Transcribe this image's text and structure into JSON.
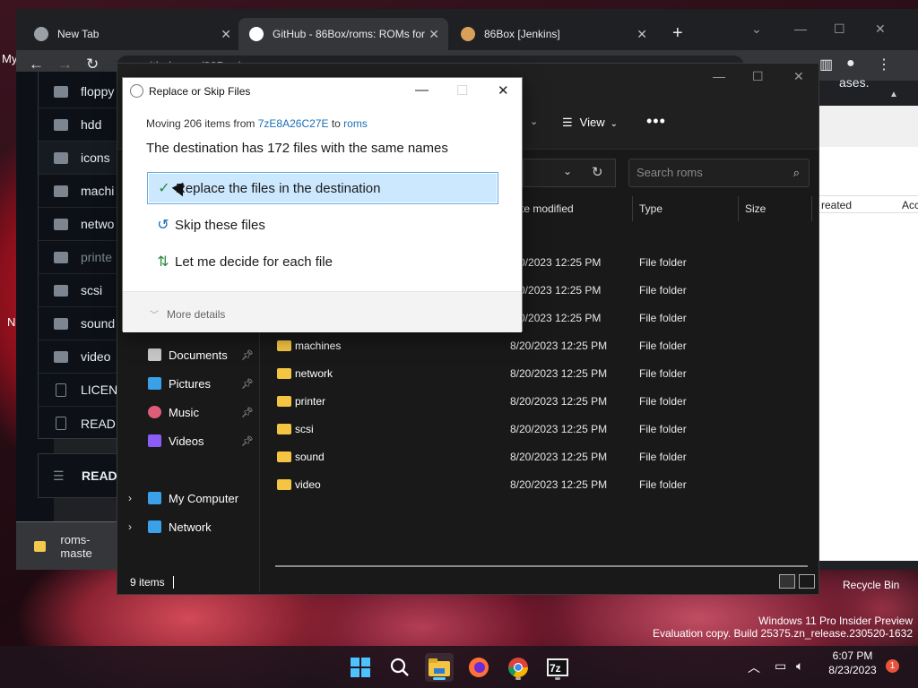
{
  "chrome": {
    "tabs": [
      {
        "title": "New Tab",
        "favicon_color": "#9aa0a6"
      },
      {
        "title": "GitHub - 86Box/roms: ROMs for",
        "favicon_color": "#ffffff"
      },
      {
        "title": "86Box [Jenkins]",
        "favicon_color": "#d9a05b"
      }
    ],
    "url": "github.com/86Box/roms",
    "downloads_item": "roms-maste",
    "page_right_fragment": "ases.",
    "page_right_col1": "reated",
    "page_right_col2": "Acc"
  },
  "github_files": {
    "rows": [
      {
        "name": "floppy",
        "kind": "folder"
      },
      {
        "name": "hdd",
        "kind": "folder"
      },
      {
        "name": "icons",
        "kind": "folder"
      },
      {
        "name": "machi",
        "kind": "folder"
      },
      {
        "name": "netwo",
        "kind": "folder"
      },
      {
        "name": "printe",
        "kind": "folder"
      },
      {
        "name": "scsi",
        "kind": "folder"
      },
      {
        "name": "sound",
        "kind": "folder"
      },
      {
        "name": "video",
        "kind": "folder"
      },
      {
        "name": "LICENS",
        "kind": "file"
      },
      {
        "name": "READM",
        "kind": "file"
      }
    ],
    "readme_header": "READM"
  },
  "desktop": {
    "left_letters": [
      "My",
      "N"
    ],
    "recycle_bin": "Recycle Bin",
    "watermark_line1": "Windows 11 Pro Insider Preview",
    "watermark_line2": "Evaluation copy. Build 25375.zn_release.230520-1632"
  },
  "explorer": {
    "view_label": "View",
    "search_placeholder": "Search roms",
    "columns": {
      "date": "te modified",
      "type": "Type",
      "size": "Size"
    },
    "nav": [
      {
        "label": "Documents",
        "pinned": true,
        "color": "#c7c7c7"
      },
      {
        "label": "Pictures",
        "pinned": true,
        "color": "#3aa0e8"
      },
      {
        "label": "Music",
        "pinned": true,
        "color": "#e05d7a"
      },
      {
        "label": "Videos",
        "pinned": true,
        "color": "#8b5cf6"
      },
      {
        "label": "My Computer",
        "pinned": false,
        "color": "#3aa0e8"
      },
      {
        "label": "Network",
        "pinned": false,
        "color": "#3aa0e8"
      }
    ],
    "files": [
      {
        "name": "",
        "date": "/20/2023 12:25 PM",
        "type": "File folder"
      },
      {
        "name": "",
        "date": "/20/2023 12:25 PM",
        "type": "File folder"
      },
      {
        "name": "",
        "date": "/20/2023 12:25 PM",
        "type": "File folder"
      },
      {
        "name": "machines",
        "date": "8/20/2023 12:25 PM",
        "type": "File folder"
      },
      {
        "name": "network",
        "date": "8/20/2023 12:25 PM",
        "type": "File folder"
      },
      {
        "name": "printer",
        "date": "8/20/2023 12:25 PM",
        "type": "File folder"
      },
      {
        "name": "scsi",
        "date": "8/20/2023 12:25 PM",
        "type": "File folder"
      },
      {
        "name": "sound",
        "date": "8/20/2023 12:25 PM",
        "type": "File folder"
      },
      {
        "name": "video",
        "date": "8/20/2023 12:25 PM",
        "type": "File folder"
      }
    ],
    "status": "9 items"
  },
  "dialog": {
    "title": "Replace or Skip Files",
    "moving_prefix": "Moving 206 items from",
    "source": "7zE8A26C27E",
    "to_word": "to",
    "destination": "roms",
    "heading": "The destination has 172 files with the same names",
    "options": [
      {
        "label": "Replace the files in the destination",
        "icon": "checkmark-icon",
        "selected": true
      },
      {
        "label": "Skip these files",
        "icon": "skip-icon",
        "selected": false
      },
      {
        "label": "Let me decide for each file",
        "icon": "compare-icon",
        "selected": false
      }
    ],
    "more_details": "More details"
  },
  "taskbar": {
    "time": "6:07 PM",
    "date": "8/23/2023",
    "notification_count": "1",
    "apps": [
      "start",
      "search",
      "file-explorer",
      "firefox",
      "chrome",
      "7zip"
    ]
  }
}
